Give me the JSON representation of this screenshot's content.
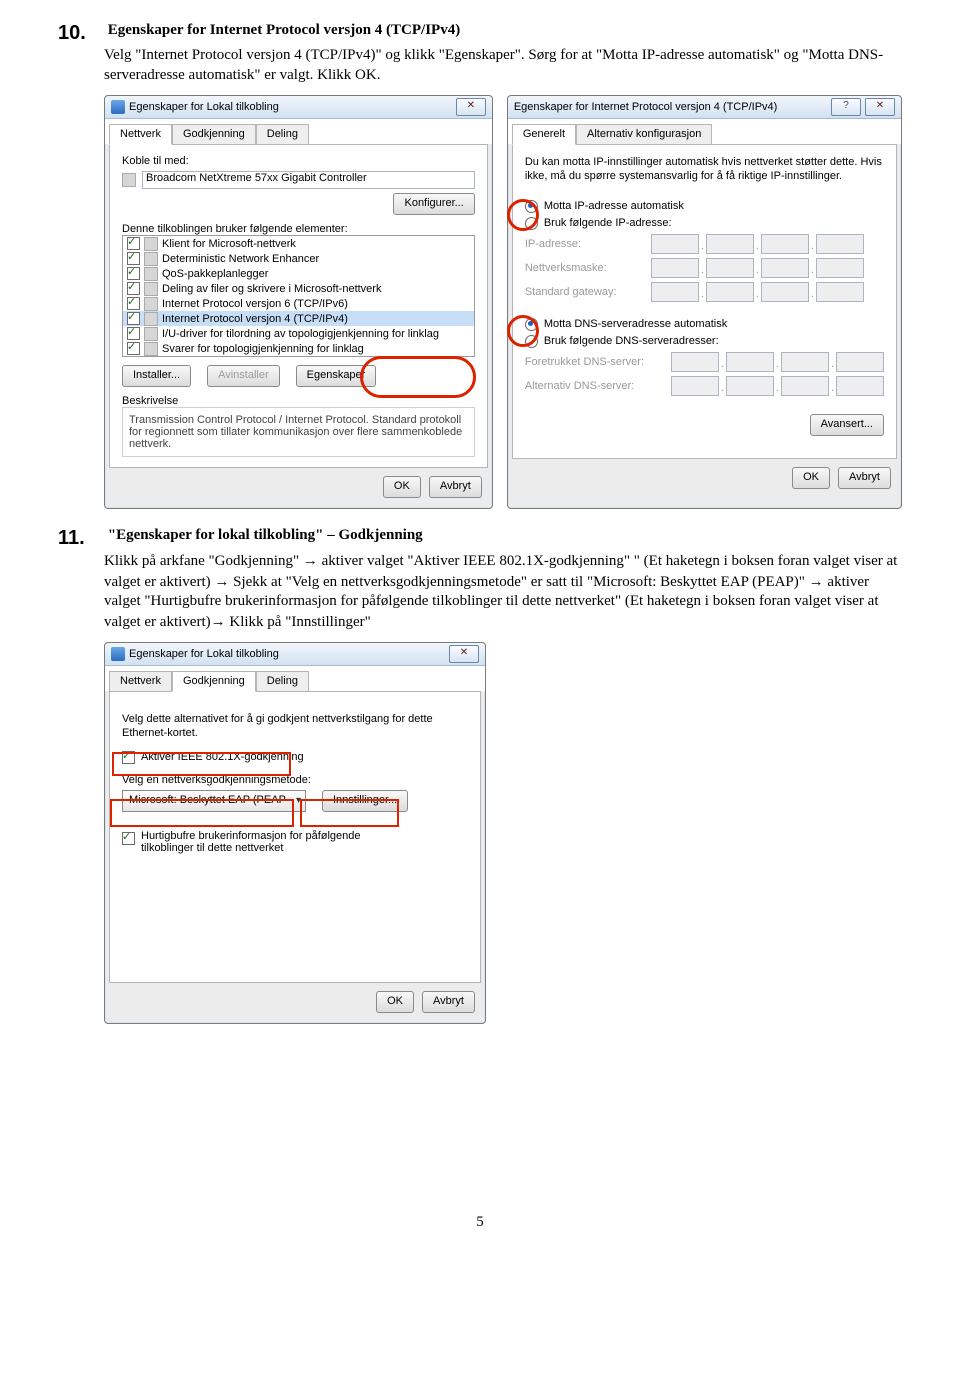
{
  "step10": {
    "num": "10.",
    "head": "Egenskaper for Internet Protocol versjon 4 (TCP/IPv4)",
    "body": "Velg \"Internet Protocol versjon 4 (TCP/IPv4)\" og klikk \"Egenskaper\". Sørg for at \"Motta IP-adresse automatisk\" og \"Motta DNS-serveradresse automatisk\" er valgt. Klikk OK."
  },
  "step11": {
    "num": "11.",
    "head": "\"Egenskaper for lokal tilkobling\" – Godkjenning",
    "body1": "Klikk på arkfane \"Godkjenning\" ",
    "body2": " aktiver valget \"Aktiver IEEE 802.1X-godkjenning\" \" (Et haketegn i boksen foran valget viser at valget er aktivert) ",
    "body3": " Sjekk at \"Velg en nettverksgodkjenningsmetode\" er satt til \"Microsoft: Beskyttet EAP (PEAP)\" ",
    "body4": " aktiver valget \"Hurtigbufre brukerinformasjon for påfølgende tilkoblinger til dette nettverket\" (Et haketegn i boksen foran valget viser at valget er aktivert)",
    "body5": " Klikk på \"Innstillinger\""
  },
  "dlg1": {
    "title": "Egenskaper for Lokal tilkobling",
    "tabs": [
      "Nettverk",
      "Godkjenning",
      "Deling"
    ],
    "koble": "Koble til med:",
    "adapter": "Broadcom NetXtreme 57xx Gigabit Controller",
    "konfig": "Konfigurer...",
    "uses": "Denne tilkoblingen bruker følgende elementer:",
    "items": [
      "Klient for Microsoft-nettverk",
      "Deterministic Network Enhancer",
      "QoS-pakkeplanlegger",
      "Deling av filer og skrivere i Microsoft-nettverk",
      "Internet Protocol versjon 6 (TCP/IPv6)",
      "Internet Protocol versjon 4 (TCP/IPv4)",
      "I/U-driver for tilordning av topologigjenkjenning for linklag",
      "Svarer for topologigjenkjenning for linklag"
    ],
    "installer": "Installer...",
    "avinst": "Avinstaller",
    "egen": "Egenskaper",
    "beskr": "Beskrivelse",
    "beskrTxt": "Transmission Control Protocol / Internet Protocol. Standard protokoll for regionnett som tillater kommunikasjon over flere sammenkoblede nettverk.",
    "ok": "OK",
    "avbryt": "Avbryt"
  },
  "dlg2": {
    "title": "Egenskaper for Internet Protocol versjon 4 (TCP/IPv4)",
    "tabs": [
      "Generelt",
      "Alternativ konfigurasjon"
    ],
    "intro": "Du kan motta IP-innstillinger automatisk hvis nettverket støtter dette. Hvis ikke, må du spørre systemansvarlig for å få riktige IP-innstillinger.",
    "r1": "Motta IP-adresse automatisk",
    "r2": "Bruk følgende IP-adresse:",
    "ip": "IP-adresse:",
    "mask": "Nettverksmaske:",
    "gw": "Standard gateway:",
    "r3": "Motta DNS-serveradresse automatisk",
    "r4": "Bruk følgende DNS-serveradresser:",
    "pdns": "Foretrukket DNS-server:",
    "adns": "Alternativ DNS-server:",
    "adv": "Avansert...",
    "ok": "OK",
    "avbryt": "Avbryt"
  },
  "dlg3": {
    "title": "Egenskaper for Lokal tilkobling",
    "tabs": [
      "Nettverk",
      "Godkjenning",
      "Deling"
    ],
    "intro": "Velg dette alternativet for å gi godkjent nettverkstilgang for dette Ethernet-kortet.",
    "chk1": "Aktiver IEEE 802.1X-godkjenning",
    "lbl": "Velg en nettverksgodkjenningsmetode:",
    "dd": "Microsoft: Beskyttet EAP (PEAP",
    "innst": "Innstillinger...",
    "chk2": "Hurtigbufre brukerinformasjon for påfølgende\ntilkoblinger til dette nettverket",
    "ok": "OK",
    "avbryt": "Avbryt"
  },
  "pgnum": "5"
}
